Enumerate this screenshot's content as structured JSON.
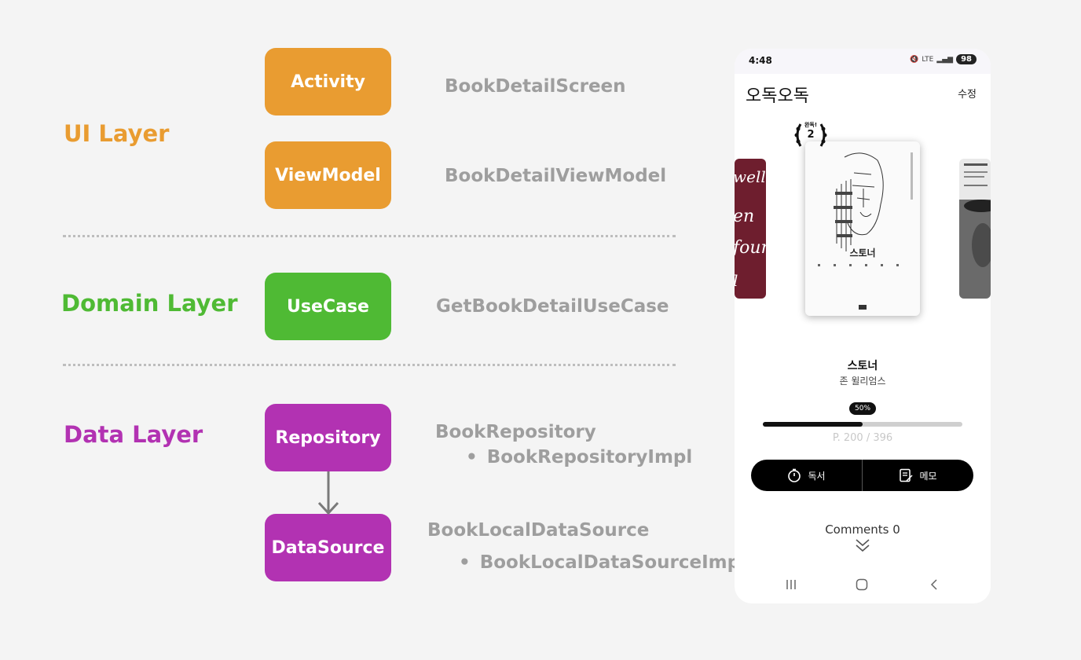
{
  "layers": {
    "ui": {
      "label": "UI Layer",
      "color": "#e99c31"
    },
    "domain": {
      "label": "Domain Layer",
      "color": "#4fba34"
    },
    "data": {
      "label": "Data Layer",
      "color": "#b232b2"
    }
  },
  "boxes": {
    "activity": "Activity",
    "viewmodel": "ViewModel",
    "usecase": "UseCase",
    "repository": "Repository",
    "datasource": "DataSource"
  },
  "classes": {
    "screen": "BookDetailScreen",
    "viewmodel": "BookDetailViewModel",
    "usecase": "GetBookDetailUseCase",
    "repository": "BookRepository",
    "repository_impl": "BookRepositoryImpl",
    "datasource": "BookLocalDataSource",
    "datasource_impl": "BookLocalDataSourceImpl"
  },
  "phone": {
    "time": "4:48",
    "network": "LTE",
    "battery": "98",
    "app_title": "오독오독",
    "edit_label": "수정",
    "badge_label": "완독!",
    "badge_count": "2",
    "book_cover_title": "스토너",
    "book_title": "스토너",
    "book_author": "존 윌리엄스",
    "progress_label": "50%",
    "progress": 0.5,
    "pages": "P. 200 / 396",
    "read_label": "독서",
    "memo_label": "메모",
    "comments_label": "Comments 0"
  }
}
